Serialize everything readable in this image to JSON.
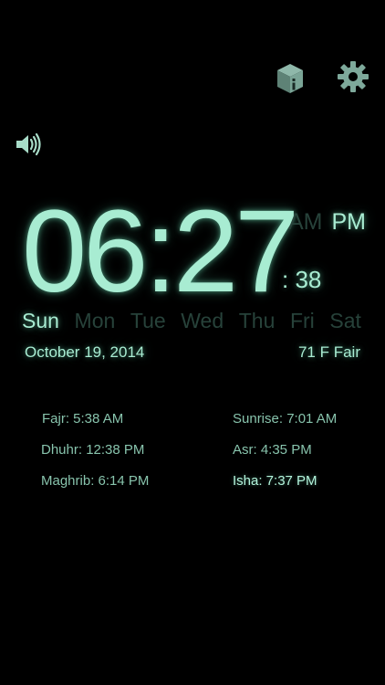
{
  "icons": {
    "info": "info-box-icon",
    "settings": "gear-icon",
    "sound": "speaker-icon"
  },
  "clock": {
    "time": "06:27",
    "am_label": "AM",
    "pm_label": "PM",
    "seconds_prefix": ":",
    "seconds": "38",
    "active_period": "PM"
  },
  "days": [
    {
      "label": "Sun",
      "active": true
    },
    {
      "label": "Mon",
      "active": false
    },
    {
      "label": "Tue",
      "active": false
    },
    {
      "label": "Wed",
      "active": false
    },
    {
      "label": "Thu",
      "active": false
    },
    {
      "label": "Fri",
      "active": false
    },
    {
      "label": "Sat",
      "active": false
    }
  ],
  "date": "October 19, 2014",
  "weather": "71 F Fair",
  "prayers": {
    "fajr": "Fajr: 5:38 AM",
    "sunrise": "Sunrise: 7:01 AM",
    "dhuhr": "Dhuhr: 12:38 PM",
    "asr": "Asr: 4:35 PM",
    "maghrib": "Maghrib: 6:14 PM",
    "isha": "Isha: 7:37 PM"
  },
  "colors": {
    "background": "#000000",
    "glow": "#a8ecd2",
    "dim": "#27423a",
    "icon": "#7ea99b"
  }
}
